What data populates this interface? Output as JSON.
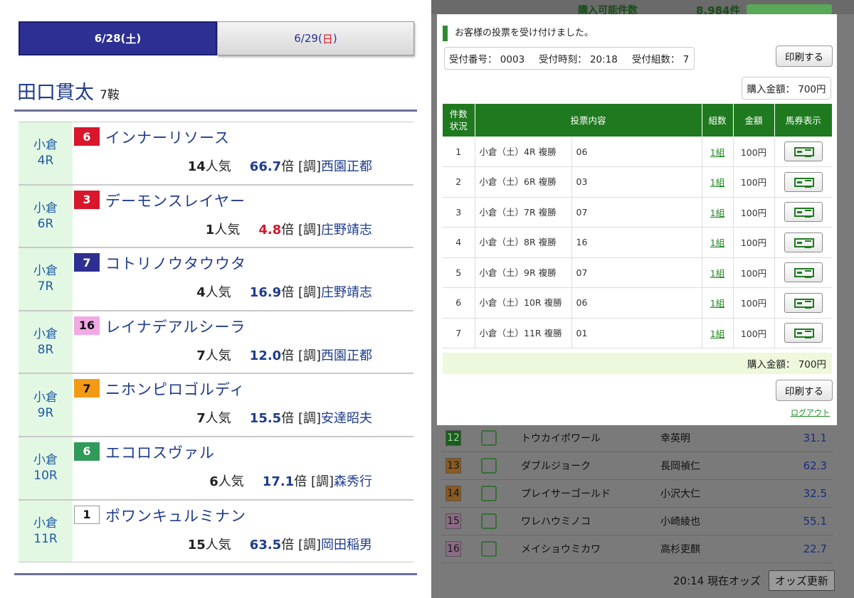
{
  "tabs": {
    "sat_prefix": "6/28(",
    "sat_day": "土",
    "sat_suffix": ")",
    "sun_prefix": "6/29(",
    "sun_day": "日",
    "sun_suffix": ")"
  },
  "jockey": {
    "name": "田口貫太",
    "rides": "7鞍"
  },
  "races": [
    {
      "venue": "小倉",
      "race": "4R",
      "num": "6",
      "num_bg": "#d8162c",
      "num_fg": "#ffffff",
      "horse": "インナーリソース",
      "pop": "14",
      "pop_unit": "人気",
      "odds": "66.7",
      "odds_unit": "倍",
      "trainer_prefix": "[調]",
      "trainer": "西園正都",
      "odds_hot": false
    },
    {
      "venue": "小倉",
      "race": "6R",
      "num": "3",
      "num_bg": "#d8162c",
      "num_fg": "#ffffff",
      "horse": "デーモンスレイヤー",
      "pop": "1",
      "pop_unit": "人気",
      "odds": "4.8",
      "odds_unit": "倍",
      "trainer_prefix": "[調]",
      "trainer": "庄野靖志",
      "odds_hot": true
    },
    {
      "venue": "小倉",
      "race": "7R",
      "num": "7",
      "num_bg": "#2d2f92",
      "num_fg": "#ffffff",
      "horse": "コトリノウタウウタ",
      "pop": "4",
      "pop_unit": "人気",
      "odds": "16.9",
      "odds_unit": "倍",
      "trainer_prefix": "[調]",
      "trainer": "庄野靖志",
      "odds_hot": false
    },
    {
      "venue": "小倉",
      "race": "8R",
      "num": "16",
      "num_bg": "#f3a9e6",
      "num_fg": "#111111",
      "horse": "レイナデアルシーラ",
      "pop": "7",
      "pop_unit": "人気",
      "odds": "12.0",
      "odds_unit": "倍",
      "trainer_prefix": "[調]",
      "trainer": "西園正都",
      "odds_hot": false
    },
    {
      "venue": "小倉",
      "race": "9R",
      "num": "7",
      "num_bg": "#f39a14",
      "num_fg": "#111111",
      "horse": "ニホンピロゴルディ",
      "pop": "7",
      "pop_unit": "人気",
      "odds": "15.5",
      "odds_unit": "倍",
      "trainer_prefix": "[調]",
      "trainer": "安達昭夫",
      "odds_hot": false
    },
    {
      "venue": "小倉",
      "race": "10R",
      "num": "6",
      "num_bg": "#2f9a5a",
      "num_fg": "#ffffff",
      "horse": "エコロスヴァル",
      "pop": "6",
      "pop_unit": "人気",
      "odds": "17.1",
      "odds_unit": "倍",
      "trainer_prefix": "[調]",
      "trainer": "森秀行",
      "odds_hot": false
    },
    {
      "venue": "小倉",
      "race": "11R",
      "num": "1",
      "num_bg": "#ffffff",
      "num_fg": "#111111",
      "horse": "ポワンキュルミナン",
      "pop": "15",
      "pop_unit": "人気",
      "odds": "63.5",
      "odds_unit": "倍",
      "trainer_prefix": "[調]",
      "trainer": "岡田稲男",
      "odds_hot": false
    }
  ],
  "background_top": {
    "label": "購入可能件数",
    "value": "8,984件"
  },
  "modal": {
    "message": "お客様の投票を受け付けました。",
    "receipt_no_label": "受付番号：",
    "receipt_no": "0003",
    "receipt_time_label": "受付時刻：",
    "receipt_time": "20:18",
    "receipt_sets_label": "受付組数：",
    "receipt_sets": "7",
    "print_label": "印刷する",
    "amount_label": "購入金額：",
    "amount": "700円",
    "headers": {
      "status_line1": "件数",
      "status_line2": "状況",
      "content": "投票内容",
      "sets": "組数",
      "price": "金額",
      "ticket": "馬券表示"
    },
    "bets": [
      {
        "no": "1",
        "race_line1": "小倉（土）4R",
        "race_line2": "複勝",
        "horse": "06",
        "sets": "1組",
        "price": "100円"
      },
      {
        "no": "2",
        "race_line1": "小倉（土）6R",
        "race_line2": "複勝",
        "horse": "03",
        "sets": "1組",
        "price": "100円"
      },
      {
        "no": "3",
        "race_line1": "小倉（土）7R",
        "race_line2": "複勝",
        "horse": "07",
        "sets": "1組",
        "price": "100円"
      },
      {
        "no": "4",
        "race_line1": "小倉（土）8R",
        "race_line2": "複勝",
        "horse": "16",
        "sets": "1組",
        "price": "100円"
      },
      {
        "no": "5",
        "race_line1": "小倉（土）9R",
        "race_line2": "複勝",
        "horse": "07",
        "sets": "1組",
        "price": "100円"
      },
      {
        "no": "6",
        "race_line1": "小倉（土）10R",
        "race_line2": "複勝",
        "horse": "06",
        "sets": "1組",
        "price": "100円"
      },
      {
        "no": "7",
        "race_line1": "小倉（土）11R",
        "race_line2": "複勝",
        "horse": "01",
        "sets": "1組",
        "price": "100円"
      }
    ],
    "total_label": "購入金額：",
    "total": "700円",
    "logout_label": "ログアウト"
  },
  "odds_list": [
    {
      "num": "12",
      "num_bg": "#1d5a1d",
      "num_fg": "#9ad89a",
      "name": "トウカイポワール",
      "jockey": "幸英明",
      "odds": "31.1"
    },
    {
      "num": "13",
      "num_bg": "#8a5a1e",
      "num_fg": "#1a1a1a",
      "name": "ダブルジョーク",
      "jockey": "長岡禎仁",
      "odds": "62.3"
    },
    {
      "num": "14",
      "num_bg": "#8a5a1e",
      "num_fg": "#1a1a1a",
      "name": "プレイサーゴールド",
      "jockey": "小沢大仁",
      "odds": "32.5"
    },
    {
      "num": "15",
      "num_bg": "#8a6a84",
      "num_fg": "#1a1a1a",
      "name": "ワレハウミノコ",
      "jockey": "小崎綾也",
      "odds": "55.1"
    },
    {
      "num": "16",
      "num_bg": "#8a6a84",
      "num_fg": "#1a1a1a",
      "name": "メイショウミカワ",
      "jockey": "高杉吏麒",
      "odds": "22.7"
    }
  ],
  "footer": {
    "time": "20:14",
    "label": "現在オッズ",
    "update_btn": "オッズ更新"
  }
}
